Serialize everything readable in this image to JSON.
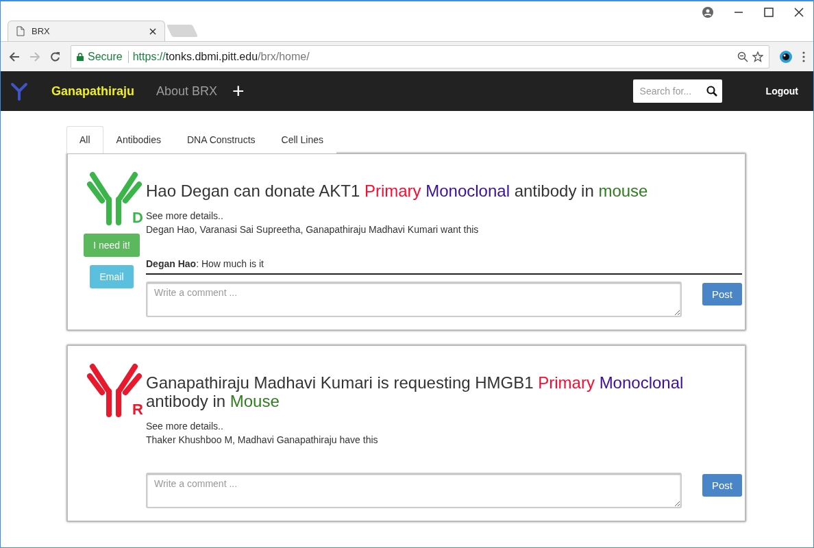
{
  "browser": {
    "tab_title": "BRX",
    "url_secure_label": "Secure",
    "url_scheme": "https://",
    "url_host": "tonks.dbmi.pitt.edu",
    "url_path": "/brx/home/"
  },
  "navbar": {
    "brand": "Ganapathiraju",
    "links": [
      "About BRX"
    ],
    "add_label": "+",
    "search": {
      "placeholder": "Search for..."
    },
    "logout": "Logout"
  },
  "tabs": [
    {
      "label": "All",
      "selected": true
    },
    {
      "label": "Antibodies",
      "selected": false
    },
    {
      "label": "DNA Constructs",
      "selected": false
    },
    {
      "label": "Cell Lines",
      "selected": false
    }
  ],
  "posts": [
    {
      "kind": "donate",
      "badge_letter": "D",
      "title_parts": [
        {
          "text": "Hao Degan can donate AKT1 ",
          "color": "#333333"
        },
        {
          "text": "Primary ",
          "color": "#ff0a2f"
        },
        {
          "text": "Monoclonal",
          "color": "#3b0f9c"
        },
        {
          "text": " antibody in ",
          "color": "#333333"
        },
        {
          "text": "mouse",
          "color": "#2e7d1e"
        }
      ],
      "details_link": "See more details..",
      "interest": "Degan Hao, Varanasi Sai Supreetha, Ganapathiraju Madhavi Kumari want this",
      "actions": [
        {
          "kind": "need",
          "label": "I need it!"
        },
        {
          "kind": "email",
          "label": "Email"
        }
      ],
      "comments": [
        "**Degan Hao**: How much is it"
      ],
      "comment_placeholder": "Write a comment ...",
      "post_label": "Post"
    },
    {
      "kind": "request",
      "badge_letter": "R",
      "title_parts": [
        {
          "text": "Ganapathiraju Madhavi Kumari is requesting HMGB1 ",
          "color": "#333333"
        },
        {
          "text": "Primary ",
          "color": "#ff0a2f"
        },
        {
          "text": "Monoclonal",
          "color": "#3b0f9c"
        },
        {
          "text": " antibody in ",
          "color": "#333333"
        },
        {
          "text": "Mouse",
          "color": "#2e7d1e"
        }
      ],
      "details_link": "See more details..",
      "interest": "Thaker Khushboo M, Madhavi Ganapathiraju have this",
      "comment_placeholder": "Write a comment ...",
      "post_label": "Post"
    }
  ]
}
